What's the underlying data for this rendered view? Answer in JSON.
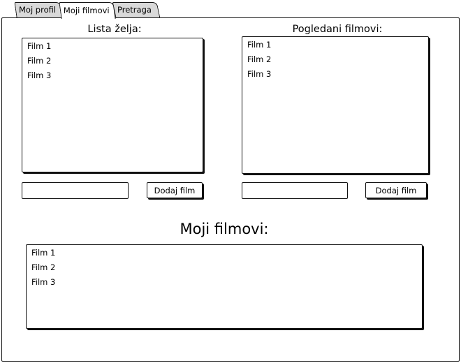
{
  "tabs": {
    "profile": "Moj profil",
    "movies": "Moji filmovi",
    "search": "Pretraga"
  },
  "wishlist": {
    "title": "Lista želja:",
    "items": [
      "Film 1",
      "Film 2",
      "Film 3"
    ],
    "input_value": "",
    "button_label": "Dodaj film"
  },
  "watched": {
    "title": "Pogledani filmovi:",
    "items": [
      "Film 1",
      "Film 2",
      "Film 3"
    ],
    "input_value": "",
    "button_label": "Dodaj film"
  },
  "my_movies": {
    "title": "Moji filmovi:",
    "items": [
      "Film 1",
      "Film 2",
      "Film 3"
    ]
  }
}
